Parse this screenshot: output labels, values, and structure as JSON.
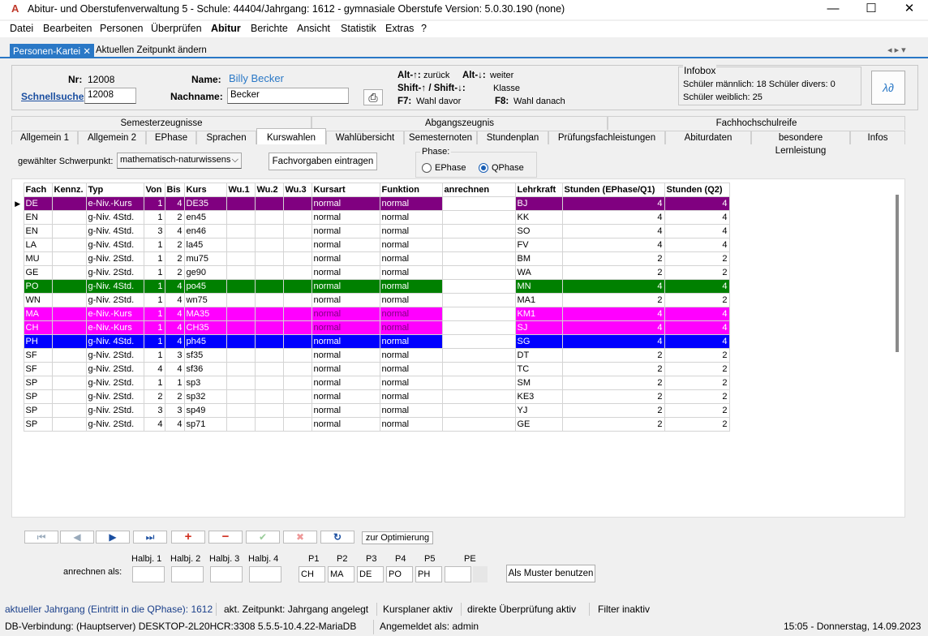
{
  "window": {
    "title": "Abitur- und Oberstufenverwaltung 5 - Schule: 44404/Jahrgang: 1612 - gymnasiale Oberstufe Version: 5.0.30.190 (none)",
    "minimize": "—",
    "maximize": "☐",
    "close": "✕"
  },
  "menu": [
    "Datei",
    "Bearbeiten",
    "Personen",
    "Überprüfen",
    "Abitur",
    "Berichte",
    "Ansicht",
    "Statistik",
    "Extras",
    "?"
  ],
  "doc_tabs": {
    "active": "Personen-Kartei",
    "close": "✕",
    "second": "Aktuellen Zeitpunkt ändern",
    "nav": "◂ ▸ ▾"
  },
  "header": {
    "nr_label": "Nr:",
    "nr_value": "12008",
    "name_label": "Name:",
    "name_value": "Billy Becker",
    "schnellsuche_label": "Schnellsuche",
    "schnellsuche_value": "12008",
    "nachname_label": "Nachname:",
    "nachname_value": "Becker",
    "hint1a": "Alt-↑:",
    "hint1b": "zurück",
    "hint1c": "Alt-↓:",
    "hint1d": "weiter",
    "hint2a": "Shift-↑ / Shift-↓:",
    "hint2b": "Klasse",
    "hint3a": "F7:",
    "hint3b": "Wahl davor",
    "hint3c": "F8:",
    "hint3d": "Wahl danach"
  },
  "infobox": {
    "title": "Infobox",
    "line1": "Schüler männlich: 18  Schüler divers: 0",
    "line2": "Schüler weiblich: 25"
  },
  "tabs_top": [
    "Semesterzeugnisse",
    "Abgangszeugnis",
    "Fachhochschulreife"
  ],
  "tabs_main": [
    "Allgemein 1",
    "Allgemein 2",
    "EPhase",
    "Sprachen",
    "Kurswahlen",
    "Wahlübersicht",
    "Semesternoten",
    "Stundenplan",
    "Prüfungsfachleistungen",
    "Abiturdaten",
    "besondere Lernleistung",
    "Infos"
  ],
  "schwerpunkt": {
    "label": "gewählter Schwerpunkt:",
    "value": "mathematisch-naturwissens",
    "button": "Fachvorgaben eintragen"
  },
  "phase": {
    "label": "Phase:",
    "option1": "EPhase",
    "option2": "QPhase",
    "selected": "QPhase"
  },
  "table": {
    "headers": [
      "Fach",
      "Kennz.",
      "Typ",
      "Von",
      "Bis",
      "Kurs",
      "Wu.1",
      "Wu.2",
      "Wu.3",
      "Kursart",
      "Funktion",
      "anrechnen",
      "Lehrkraft",
      "Stunden (EPhase/Q1)",
      "Stunden (Q2)"
    ],
    "rows": [
      {
        "style": "violet",
        "cells": [
          "DE",
          "",
          "e-Niv.-Kurs",
          "1",
          "4",
          "DE35",
          "",
          "",
          "",
          "normal",
          "normal",
          "",
          "BJ",
          "4",
          "4"
        ]
      },
      {
        "style": "",
        "cells": [
          "EN",
          "",
          "g-Niv. 4Std.",
          "1",
          "2",
          "en45",
          "",
          "",
          "",
          "normal",
          "normal",
          "",
          "KK",
          "4",
          "4"
        ]
      },
      {
        "style": "",
        "cells": [
          "EN",
          "",
          "g-Niv. 4Std.",
          "3",
          "4",
          "en46",
          "",
          "",
          "",
          "normal",
          "normal",
          "",
          "SO",
          "4",
          "4"
        ]
      },
      {
        "style": "",
        "cells": [
          "LA",
          "",
          "g-Niv. 4Std.",
          "1",
          "2",
          "la45",
          "",
          "",
          "",
          "normal",
          "normal",
          "",
          "FV",
          "4",
          "4"
        ]
      },
      {
        "style": "",
        "cells": [
          "MU",
          "",
          "g-Niv. 2Std.",
          "1",
          "2",
          "mu75",
          "",
          "",
          "",
          "normal",
          "normal",
          "",
          "BM",
          "2",
          "2"
        ]
      },
      {
        "style": "",
        "cells": [
          "GE",
          "",
          "g-Niv. 2Std.",
          "1",
          "2",
          "ge90",
          "",
          "",
          "",
          "normal",
          "normal",
          "",
          "WA",
          "2",
          "2"
        ]
      },
      {
        "style": "green",
        "cells": [
          "PO",
          "",
          "g-Niv. 4Std.",
          "1",
          "4",
          "po45",
          "",
          "",
          "",
          "normal",
          "normal",
          "",
          "MN",
          "4",
          "4"
        ]
      },
      {
        "style": "",
        "cells": [
          "WN",
          "",
          "g-Niv. 2Std.",
          "1",
          "4",
          "wn75",
          "",
          "",
          "",
          "normal",
          "normal",
          "",
          "MA1",
          "2",
          "2"
        ]
      },
      {
        "style": "magenta",
        "cells": [
          "MA",
          "",
          "e-Niv.-Kurs",
          "1",
          "4",
          "MA35",
          "",
          "",
          "",
          "normal",
          "normal",
          "",
          "KM1",
          "4",
          "4"
        ]
      },
      {
        "style": "magenta",
        "cells": [
          "CH",
          "",
          "e-Niv.-Kurs",
          "1",
          "4",
          "CH35",
          "",
          "",
          "",
          "normal",
          "normal",
          "",
          "SJ",
          "4",
          "4"
        ]
      },
      {
        "style": "blue",
        "cells": [
          "PH",
          "",
          "g-Niv. 4Std.",
          "1",
          "4",
          "ph45",
          "",
          "",
          "",
          "normal",
          "normal",
          "",
          "SG",
          "4",
          "4"
        ]
      },
      {
        "style": "",
        "cells": [
          "SF",
          "",
          "g-Niv. 2Std.",
          "1",
          "3",
          "sf35",
          "",
          "",
          "",
          "normal",
          "normal",
          "",
          "DT",
          "2",
          "2"
        ]
      },
      {
        "style": "",
        "cells": [
          "SF",
          "",
          "g-Niv. 2Std.",
          "4",
          "4",
          "sf36",
          "",
          "",
          "",
          "normal",
          "normal",
          "",
          "TC",
          "2",
          "2"
        ]
      },
      {
        "style": "",
        "cells": [
          "SP",
          "",
          "g-Niv. 2Std.",
          "1",
          "1",
          "sp3",
          "",
          "",
          "",
          "normal",
          "normal",
          "",
          "SM",
          "2",
          "2"
        ]
      },
      {
        "style": "",
        "cells": [
          "SP",
          "",
          "g-Niv. 2Std.",
          "2",
          "2",
          "sp32",
          "",
          "",
          "",
          "normal",
          "normal",
          "",
          "KE3",
          "2",
          "2"
        ]
      },
      {
        "style": "",
        "cells": [
          "SP",
          "",
          "g-Niv. 2Std.",
          "3",
          "3",
          "sp49",
          "",
          "",
          "",
          "normal",
          "normal",
          "",
          "YJ",
          "2",
          "2"
        ]
      },
      {
        "style": "",
        "cells": [
          "SP",
          "",
          "g-Niv. 2Std.",
          "4",
          "4",
          "sp71",
          "",
          "",
          "",
          "normal",
          "normal",
          "",
          "GE",
          "2",
          "2"
        ]
      }
    ]
  },
  "nav": {
    "first": "⏮",
    "prev": "◀",
    "next": "▶",
    "last": "⏭",
    "add": "+",
    "remove": "−",
    "ok": "✔",
    "cancel": "✖",
    "refresh": "↻",
    "optimize": "zur Optimierung"
  },
  "bottom": {
    "anrechnen_label": "anrechnen als:",
    "halbj": [
      "Halbj. 1",
      "Halbj. 2",
      "Halbj. 3",
      "Halbj. 4"
    ],
    "p_labels": [
      "P1",
      "P2",
      "P3",
      "P4",
      "P5",
      "PE"
    ],
    "p_values": [
      "CH",
      "MA",
      "DE",
      "PO",
      "PH",
      ""
    ],
    "muster_button": "Als Muster benutzen"
  },
  "status1": {
    "jahrgang": "aktueller Jahrgang (Eintritt in die QPhase): 1612",
    "zeitpunkt": "akt. Zeitpunkt: Jahrgang angelegt",
    "kursplaner": "Kursplaner aktiv",
    "pruefung": "direkte Überprüfung aktiv",
    "filter": "Filter inaktiv"
  },
  "status2": {
    "db": "DB-Verbindung: (Hauptserver) DESKTOP-2L20HCR:3308 5.5.5-10.4.22-MariaDB",
    "user": "Angemeldet als: admin",
    "datetime": "15:05 - Donnerstag, 14.09.2023"
  },
  "colors": {
    "violet": "#800080",
    "green": "#008000",
    "magenta": "#ff00ff",
    "blue": "#0000ff",
    "accent": "#2a78c6"
  }
}
